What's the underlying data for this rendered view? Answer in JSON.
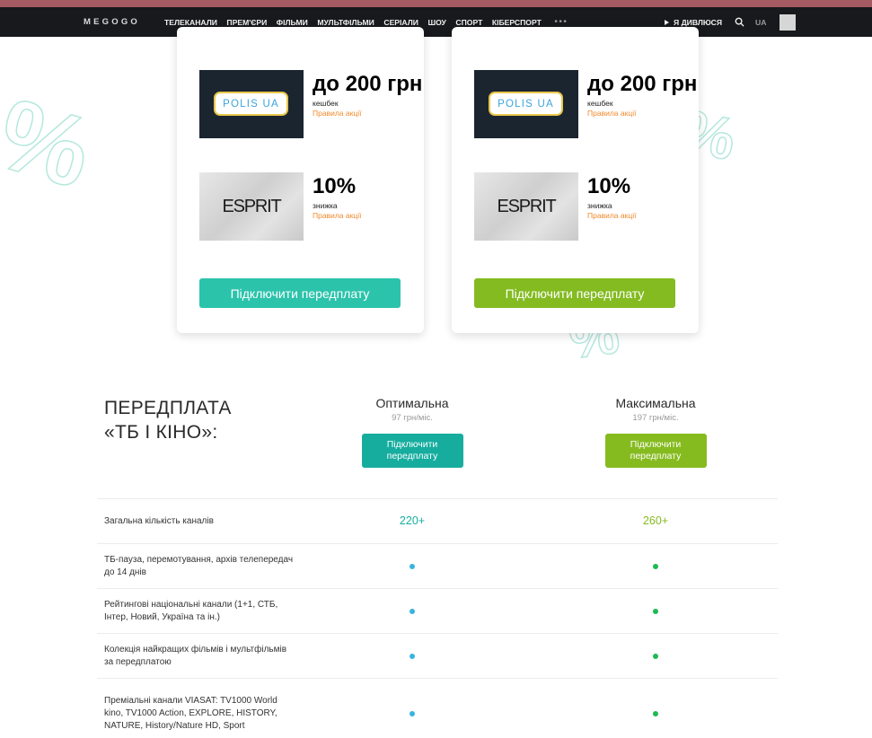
{
  "nav": {
    "logo": "MEGOGO",
    "items": [
      "ТЕЛЕКАНАЛИ",
      "ПРЕМ'ЄРИ",
      "ФІЛЬМИ",
      "МУЛЬТФІЛЬМИ",
      "СЕРІАЛИ",
      "ШОУ",
      "СПОРТ",
      "КІБЕРСПОРТ"
    ],
    "more": "•••",
    "watching": "Я ДИВЛЮСЯ",
    "lang": "UA"
  },
  "decor": {
    "percent": "%"
  },
  "cards": [
    {
      "offers": [
        {
          "logo_text": "POLIS UA",
          "value": "до 200 грн",
          "type": "кешбек",
          "rules": "Правила акції"
        },
        {
          "logo_text": "ESPRIT",
          "value": "10%",
          "type": "знижка",
          "rules": "Правила акції"
        }
      ],
      "button": "Підключити передплату",
      "button_color": "#2cc3ab"
    },
    {
      "offers": [
        {
          "logo_text": "POLIS UA",
          "value": "до 200 грн",
          "type": "кешбек",
          "rules": "Правила акції"
        },
        {
          "logo_text": "ESPRIT",
          "value": "10%",
          "type": "знижка",
          "rules": "Правила акції"
        }
      ],
      "button": "Підключити передплату",
      "button_color": "#83bb21"
    }
  ],
  "plans": {
    "title_line1": "ПЕРЕДПЛАТА",
    "title_line2": "«ТБ І КІНО»:",
    "columns": [
      {
        "name": "Оптимальна",
        "price": "97 грн/міс.",
        "button": "Підключити передплату",
        "color": "#16ad9f"
      },
      {
        "name": "Максимальна",
        "price": "197 грн/міс.",
        "button": "Підключити передплату",
        "color": "#86bb20"
      }
    ],
    "features": [
      {
        "label": "Загальна кількість каналів",
        "values": [
          "220+",
          "260+"
        ]
      },
      {
        "label": "ТБ-пауза, перемотування, архів телепередач до 14 днів",
        "values": [
          "dot",
          "dot"
        ]
      },
      {
        "label": "Рейтингові національні канали (1+1, СТБ, Інтер, Новий, Україна та ін.)",
        "values": [
          "dot",
          "dot"
        ]
      },
      {
        "label": "Колекція найкращих фільмів і мультфільмів за передплатою",
        "values": [
          "dot",
          "dot"
        ]
      },
      {
        "label": "Преміальні канали VIASAT: TV1000 World kino, TV1000 Action, EXPLORE, HISTORY, NATURE, History/Nature HD, Sport",
        "values": [
          "dot",
          "dot"
        ]
      }
    ]
  }
}
